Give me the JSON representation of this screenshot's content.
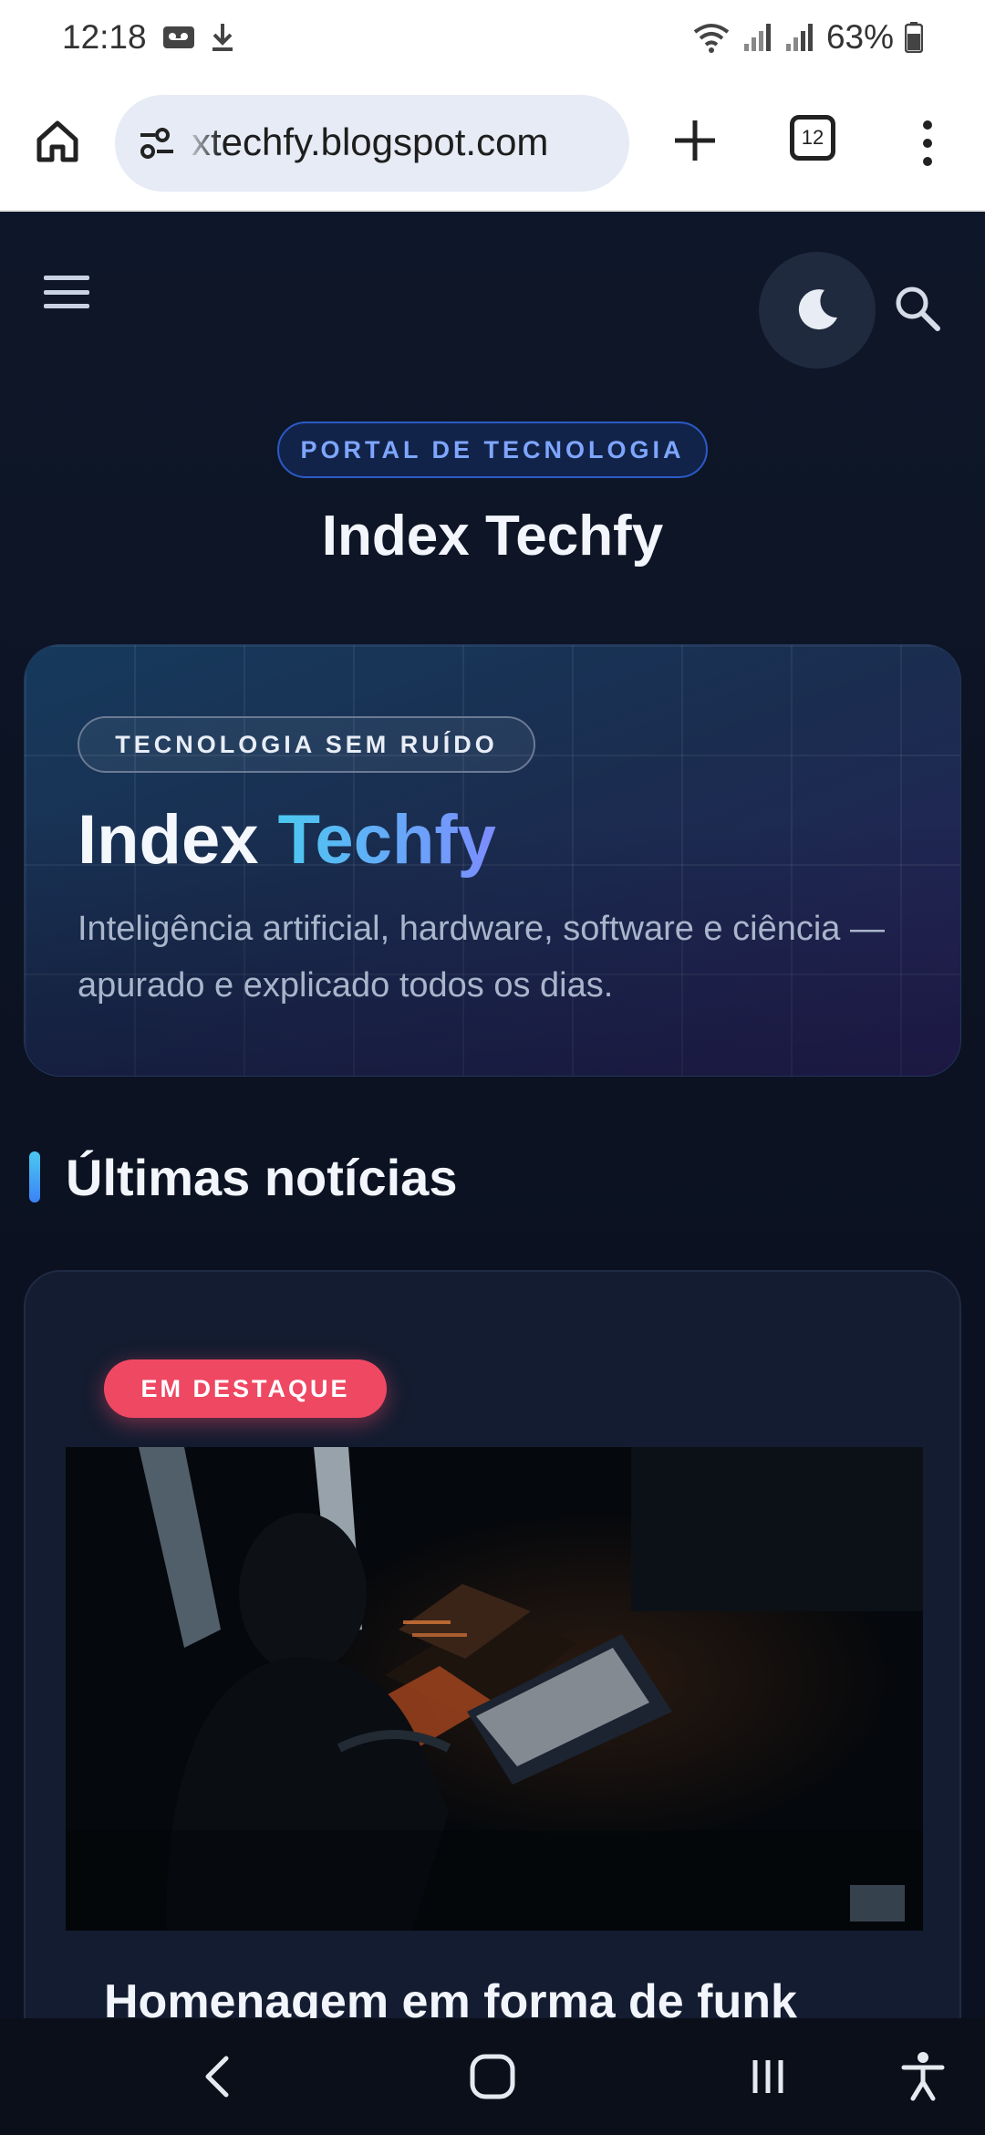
{
  "status_bar": {
    "time": "12:18",
    "battery": "63%"
  },
  "browser": {
    "url": "xtechfy.blogspot.com",
    "tab_count": "12"
  },
  "header": {
    "portal_label": "PORTAL DE TECNOLOGIA",
    "site_title": "Index Techfy"
  },
  "hero": {
    "eyebrow": "TECNOLOGIA SEM RUÍDO",
    "title_main": "Index",
    "title_accent": "Techfy",
    "description": "Inteligência artificial, hardware, software e ciência — apurado e explicado todos os dias."
  },
  "section": {
    "title": "Últimas notícias"
  },
  "featured": {
    "badge": "EM DESTAQUE",
    "headline": "Homenagem em forma de funk"
  },
  "colors": {
    "background": "#0b1120",
    "accent_cyan": "#4cc9f0",
    "accent_violet": "#7c8cff",
    "badge_red": "#ef4863"
  }
}
